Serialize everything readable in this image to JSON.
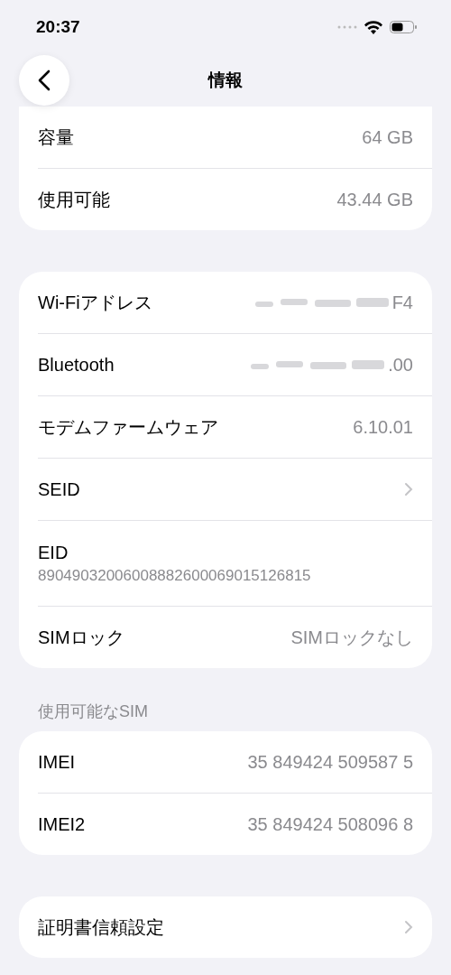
{
  "status_bar": {
    "time": "20:37"
  },
  "nav": {
    "title": "情報"
  },
  "sections": [
    {
      "cut_top": true,
      "rows": [
        {
          "kind": "value",
          "label": "容量",
          "value": "64 GB"
        },
        {
          "kind": "value",
          "label": "使用可能",
          "value": "43.44 GB"
        }
      ]
    },
    {
      "cut_top": false,
      "rows": [
        {
          "kind": "redacted",
          "label": "Wi-Fiアドレス",
          "value": "F4"
        },
        {
          "kind": "redacted",
          "label": "Bluetooth",
          "value": ".00"
        },
        {
          "kind": "value",
          "label": "モデムファームウェア",
          "value": "6.10.01"
        },
        {
          "kind": "chevron",
          "label": "SEID"
        },
        {
          "kind": "stacked",
          "label": "EID",
          "value": "89049032006008882600069015126815"
        },
        {
          "kind": "value",
          "label": "SIMロック",
          "value": "SIMロックなし"
        }
      ]
    },
    {
      "header": "使用可能なSIM",
      "cut_top": false,
      "rows": [
        {
          "kind": "value",
          "label": "IMEI",
          "value": "35 849424 509587 5"
        },
        {
          "kind": "value",
          "label": "IMEI2",
          "value": "35 849424 508096 8"
        }
      ]
    },
    {
      "cut_top": false,
      "rows": [
        {
          "kind": "chevron",
          "label": "証明書信頼設定"
        }
      ]
    }
  ]
}
